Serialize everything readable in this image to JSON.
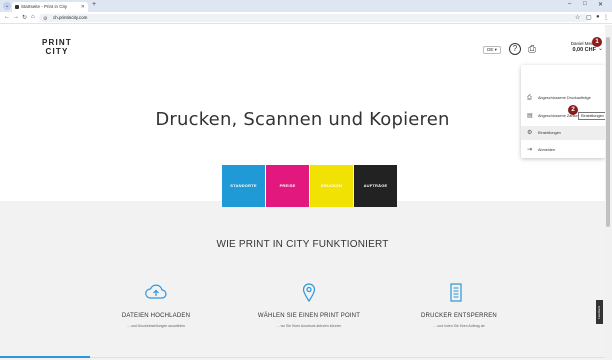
{
  "browser": {
    "tab_title": "Startseite - Print in City",
    "new_tab": "+",
    "url": "ch.printincity.com"
  },
  "header": {
    "logo_line1": "PRINT",
    "logo_line2": "CITY",
    "lang": "DE",
    "user_name": "Daniel Meier",
    "balance": "0,00 CHF"
  },
  "menu": {
    "items": [
      {
        "label": "Abgeschlossene Druckaufträge",
        "icon": "print-history-icon"
      },
      {
        "label": "Abgeschlossene Zahlungen",
        "icon": "payments-icon"
      },
      {
        "label": "Einstellungen",
        "icon": "gear-icon"
      },
      {
        "label": "Abmelden",
        "icon": "logout-icon"
      }
    ],
    "tooltip": "Einstellungen"
  },
  "steps_badges": {
    "one": "1",
    "two": "2"
  },
  "hero": {
    "title": "Drucken, Scannen und Kopieren"
  },
  "actions": [
    {
      "label": "STANDORTE",
      "color": "#1f9ad6"
    },
    {
      "label": "PREISE",
      "color": "#e2187e"
    },
    {
      "label": "DRUCKEN",
      "color": "#f2e204"
    },
    {
      "label": "AUFTRÄGE",
      "color": "#222222"
    }
  ],
  "how": {
    "title": "WIE PRINT IN CITY FUNKTIONIERT",
    "steps": [
      {
        "title": "DATEIEN HOCHLADEN",
        "sub": "... und Druckeinstellungen auswählen",
        "icon": "cloud-upload-icon"
      },
      {
        "title": "WÄHLEN SIE EINEN PRINT POINT",
        "sub": "... wo Sie Ihren Ausdruck abholen können",
        "icon": "location-pin-icon"
      },
      {
        "title": "DRUCKER ENTSPERREN",
        "sub": "... und holen Sie Ihren Auftrag ab",
        "icon": "document-icon"
      }
    ]
  },
  "feedback": "Feedback",
  "colors": {
    "accent": "#2c97dd",
    "badge": "#8b1a1a",
    "band": "#f2f2f2"
  }
}
